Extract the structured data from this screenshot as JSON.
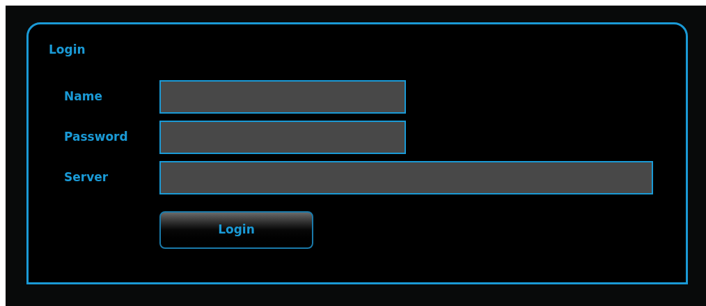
{
  "panel": {
    "title": "Login"
  },
  "fields": [
    {
      "label": "Name",
      "kind": "short"
    },
    {
      "label": "Password",
      "kind": "short"
    },
    {
      "label": "Server",
      "kind": "wide"
    }
  ],
  "button": {
    "label": "Login"
  }
}
